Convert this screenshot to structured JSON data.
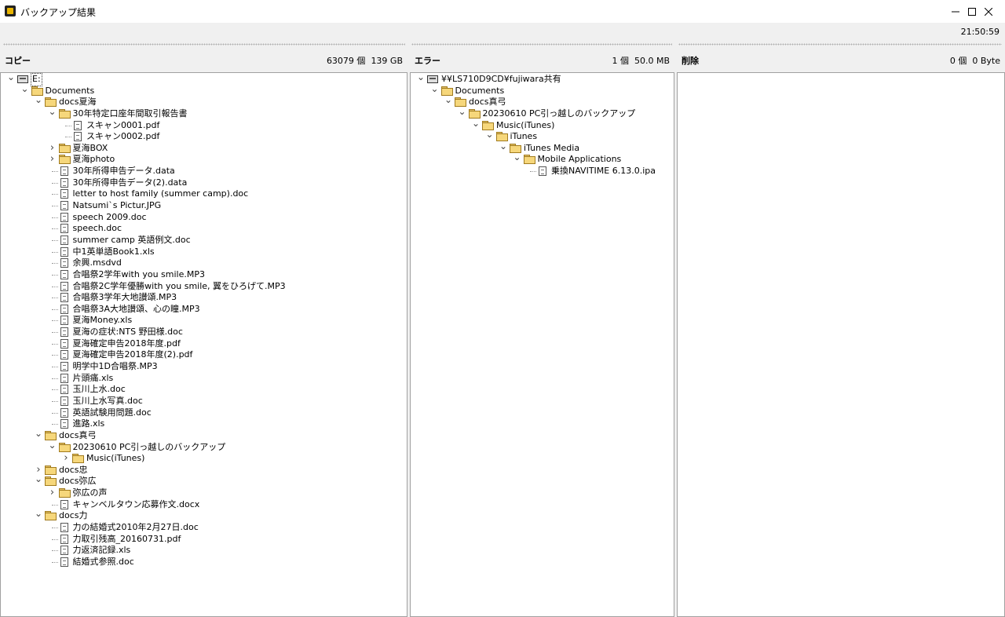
{
  "window": {
    "title": "バックアップ結果"
  },
  "clock": "21:50:59",
  "panes": [
    {
      "id": "copy",
      "label": "コピー",
      "count": "63079 個",
      "size": "139 GB",
      "tree": [
        {
          "d": 0,
          "t": "drive",
          "e": "v",
          "label": "E:",
          "sel": true
        },
        {
          "d": 1,
          "t": "folder",
          "e": "v",
          "label": "Documents"
        },
        {
          "d": 2,
          "t": "folder",
          "e": "v",
          "label": "docs夏海"
        },
        {
          "d": 3,
          "t": "folder",
          "e": "v",
          "label": "30年特定口座年間取引報告書"
        },
        {
          "d": 4,
          "t": "file",
          "e": "",
          "label": "スキャン0001.pdf"
        },
        {
          "d": 4,
          "t": "file",
          "e": "",
          "label": "スキャン0002.pdf"
        },
        {
          "d": 3,
          "t": "folder",
          "e": ">",
          "label": "夏海BOX"
        },
        {
          "d": 3,
          "t": "folder",
          "e": ">",
          "label": "夏海photo"
        },
        {
          "d": 3,
          "t": "file",
          "e": "",
          "label": "30年所得申告データ.data"
        },
        {
          "d": 3,
          "t": "file",
          "e": "",
          "label": "30年所得申告データ(2).data"
        },
        {
          "d": 3,
          "t": "file",
          "e": "",
          "label": "letter to host family (summer camp).doc"
        },
        {
          "d": 3,
          "t": "file",
          "e": "",
          "label": "Natsumi`s Pictur.JPG"
        },
        {
          "d": 3,
          "t": "file",
          "e": "",
          "label": "speech 2009.doc"
        },
        {
          "d": 3,
          "t": "file",
          "e": "",
          "label": "speech.doc"
        },
        {
          "d": 3,
          "t": "file",
          "e": "",
          "label": "summer camp 英語例文.doc"
        },
        {
          "d": 3,
          "t": "file",
          "e": "",
          "label": "中1英単語Book1.xls"
        },
        {
          "d": 3,
          "t": "file",
          "e": "",
          "label": "余興.msdvd"
        },
        {
          "d": 3,
          "t": "file",
          "e": "",
          "label": "合唱祭2学年with you smile.MP3"
        },
        {
          "d": 3,
          "t": "file",
          "e": "",
          "label": "合唱祭2C学年優勝with you smile, 翼をひろげて.MP3"
        },
        {
          "d": 3,
          "t": "file",
          "e": "",
          "label": "合唱祭3学年大地讃頌.MP3"
        },
        {
          "d": 3,
          "t": "file",
          "e": "",
          "label": "合唱祭3A大地讃頌、心の瞳.MP3"
        },
        {
          "d": 3,
          "t": "file",
          "e": "",
          "label": "夏海Money.xls"
        },
        {
          "d": 3,
          "t": "file",
          "e": "",
          "label": "夏海の症状:NTS 野田様.doc"
        },
        {
          "d": 3,
          "t": "file",
          "e": "",
          "label": "夏海確定申告2018年度.pdf"
        },
        {
          "d": 3,
          "t": "file",
          "e": "",
          "label": "夏海確定申告2018年度(2).pdf"
        },
        {
          "d": 3,
          "t": "file",
          "e": "",
          "label": "明学中1D合唱祭.MP3"
        },
        {
          "d": 3,
          "t": "file",
          "e": "",
          "label": "片頭痛.xls"
        },
        {
          "d": 3,
          "t": "file",
          "e": "",
          "label": "玉川上水.doc"
        },
        {
          "d": 3,
          "t": "file",
          "e": "",
          "label": "玉川上水写真.doc"
        },
        {
          "d": 3,
          "t": "file",
          "e": "",
          "label": "英語試験用問題.doc"
        },
        {
          "d": 3,
          "t": "file",
          "e": "",
          "label": "進路.xls"
        },
        {
          "d": 2,
          "t": "folder",
          "e": "v",
          "label": "docs真弓"
        },
        {
          "d": 3,
          "t": "folder",
          "e": "v",
          "label": "20230610 PC引っ越しのバックアップ"
        },
        {
          "d": 4,
          "t": "folder",
          "e": ">",
          "label": "Music(iTunes)"
        },
        {
          "d": 2,
          "t": "folder",
          "e": ">",
          "label": "docs忠"
        },
        {
          "d": 2,
          "t": "folder",
          "e": "v",
          "label": "docs弥広"
        },
        {
          "d": 3,
          "t": "folder",
          "e": ">",
          "label": "弥広の声"
        },
        {
          "d": 3,
          "t": "file",
          "e": "",
          "label": "キャンベルタウン応募作文.docx"
        },
        {
          "d": 2,
          "t": "folder",
          "e": "v",
          "label": "docs力"
        },
        {
          "d": 3,
          "t": "file",
          "e": "",
          "label": "力の結婚式2010年2月27日.doc"
        },
        {
          "d": 3,
          "t": "file",
          "e": "",
          "label": "力取引残高_20160731.pdf"
        },
        {
          "d": 3,
          "t": "file",
          "e": "",
          "label": "力返済記録.xls"
        },
        {
          "d": 3,
          "t": "file",
          "e": "",
          "label": "結婚式参照.doc"
        }
      ]
    },
    {
      "id": "error",
      "label": "エラー",
      "count": "1 個",
      "size": "50.0 MB",
      "tree": [
        {
          "d": 0,
          "t": "drive",
          "e": "v",
          "label": "¥¥LS710D9CD¥fujiwara共有"
        },
        {
          "d": 1,
          "t": "folder",
          "e": "v",
          "label": "Documents"
        },
        {
          "d": 2,
          "t": "folder",
          "e": "v",
          "label": "docs真弓"
        },
        {
          "d": 3,
          "t": "folder",
          "e": "v",
          "label": "20230610 PC引っ越しのバックアップ"
        },
        {
          "d": 4,
          "t": "folder",
          "e": "v",
          "label": "Music(iTunes)"
        },
        {
          "d": 5,
          "t": "folder",
          "e": "v",
          "label": "iTunes"
        },
        {
          "d": 6,
          "t": "folder",
          "e": "v",
          "label": "iTunes Media"
        },
        {
          "d": 7,
          "t": "folder",
          "e": "v",
          "label": "Mobile Applications"
        },
        {
          "d": 8,
          "t": "file",
          "e": "",
          "label": "乗換NAVITIME 6.13.0.ipa"
        }
      ]
    },
    {
      "id": "delete",
      "label": "削除",
      "count": "0 個",
      "size": "0 Byte",
      "tree": []
    }
  ]
}
